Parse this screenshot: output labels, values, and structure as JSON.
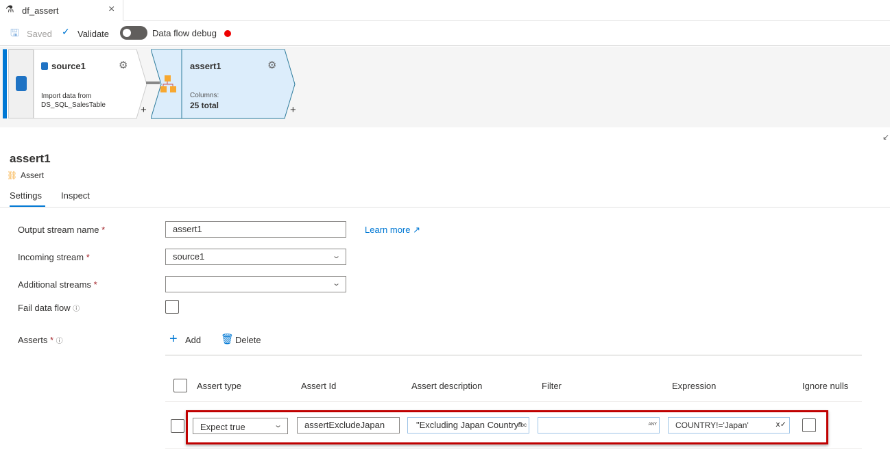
{
  "tab": {
    "title": "df_assert",
    "close": "×"
  },
  "toolbar": {
    "saved": "Saved",
    "validate": "Validate",
    "debug": "Data flow debug"
  },
  "nodes": {
    "source": {
      "title": "source1",
      "desc1": "Import data from",
      "desc2": "DS_SQL_SalesTable"
    },
    "assert": {
      "title": "assert1",
      "columns_label": "Columns:",
      "columns_value": "25 total"
    },
    "plus": "+"
  },
  "panel": {
    "title": "assert1",
    "type": "Assert",
    "tabs": [
      "Settings",
      "Inspect"
    ]
  },
  "form": {
    "output_label": "Output stream name",
    "output_value": "assert1",
    "learn_more": "Learn more",
    "incoming_label": "Incoming stream",
    "incoming_value": "source1",
    "additional_label": "Additional streams",
    "additional_value": "",
    "fail_label": "Fail data flow",
    "asserts_label": "Asserts",
    "required": "*",
    "add": "Add",
    "delete": "Delete"
  },
  "table": {
    "headers": [
      "Assert type",
      "Assert Id",
      "Assert description",
      "Filter",
      "Expression",
      "Ignore nulls"
    ],
    "row": {
      "type": "Expect true",
      "id": "assertExcludeJapan",
      "description": "\"Excluding Japan Country\"",
      "desc_badge": "abc",
      "filter": "",
      "filter_badge": "ANY",
      "expression": "COUNTRY!='Japan'"
    }
  },
  "colors": {
    "accent": "#0078d4",
    "highlight": "#c00000",
    "node_selected": "#dcedfb"
  }
}
